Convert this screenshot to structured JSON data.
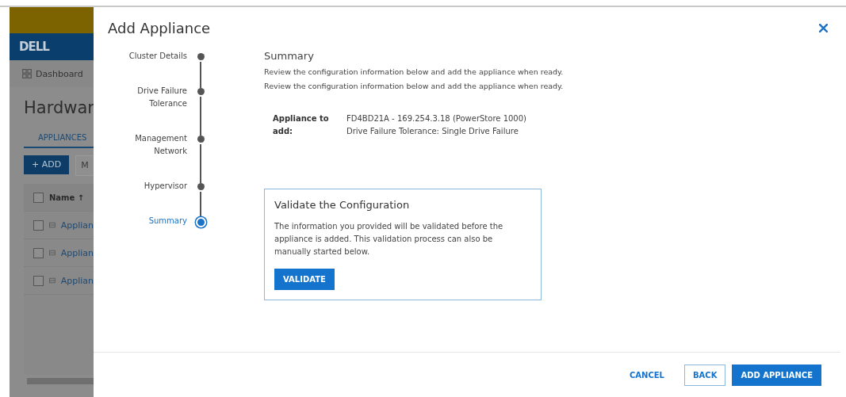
{
  "background_app": {
    "logo": "DELL",
    "nav_item": "Dashboard",
    "page_title": "Hardwar",
    "tabs": [
      {
        "label": "APPLIANCES",
        "selected": true
      }
    ],
    "buttons": [
      {
        "label": "+ ADD",
        "kind": "primary"
      },
      {
        "label": "M",
        "kind": "secondary"
      }
    ],
    "table": {
      "all_checked": false,
      "columns": [
        "Name ↑"
      ],
      "rows": [
        {
          "name": "Applian",
          "checked": false
        },
        {
          "name": "Applian",
          "checked": false
        },
        {
          "name": "Applian",
          "checked": false
        }
      ]
    }
  },
  "dialog": {
    "title": "Add Appliance",
    "steps": [
      {
        "label": "Cluster Details",
        "selected": false
      },
      {
        "label": "Drive Failure Tolerance",
        "selected": false
      },
      {
        "label": "Management Network",
        "selected": false
      },
      {
        "label": "Hypervisor",
        "selected": false
      },
      {
        "label": "Summary",
        "selected": true
      }
    ],
    "section_title": "Summary",
    "descriptions": [
      "Review the configuration information below and add the appliance when ready.",
      "Review the configuration information below and add the appliance when ready."
    ],
    "details": [
      {
        "label": "Appliance to add:",
        "values": [
          "FD4BD21A - 169.254.3.18 (PowerStore 1000)",
          "Drive Failure Tolerance: Single Drive Failure"
        ]
      }
    ],
    "validate_panel": {
      "title": "Validate the Configuration",
      "text": "The information you provided will be validated before the appliance is added. This validation process can also be manually started below.",
      "button": "VALIDATE"
    },
    "footer_buttons": [
      {
        "label": "CANCEL",
        "kind": "link"
      },
      {
        "label": "BACK",
        "kind": "outline"
      },
      {
        "label": "ADD APPLIANCE",
        "kind": "primary"
      }
    ]
  }
}
